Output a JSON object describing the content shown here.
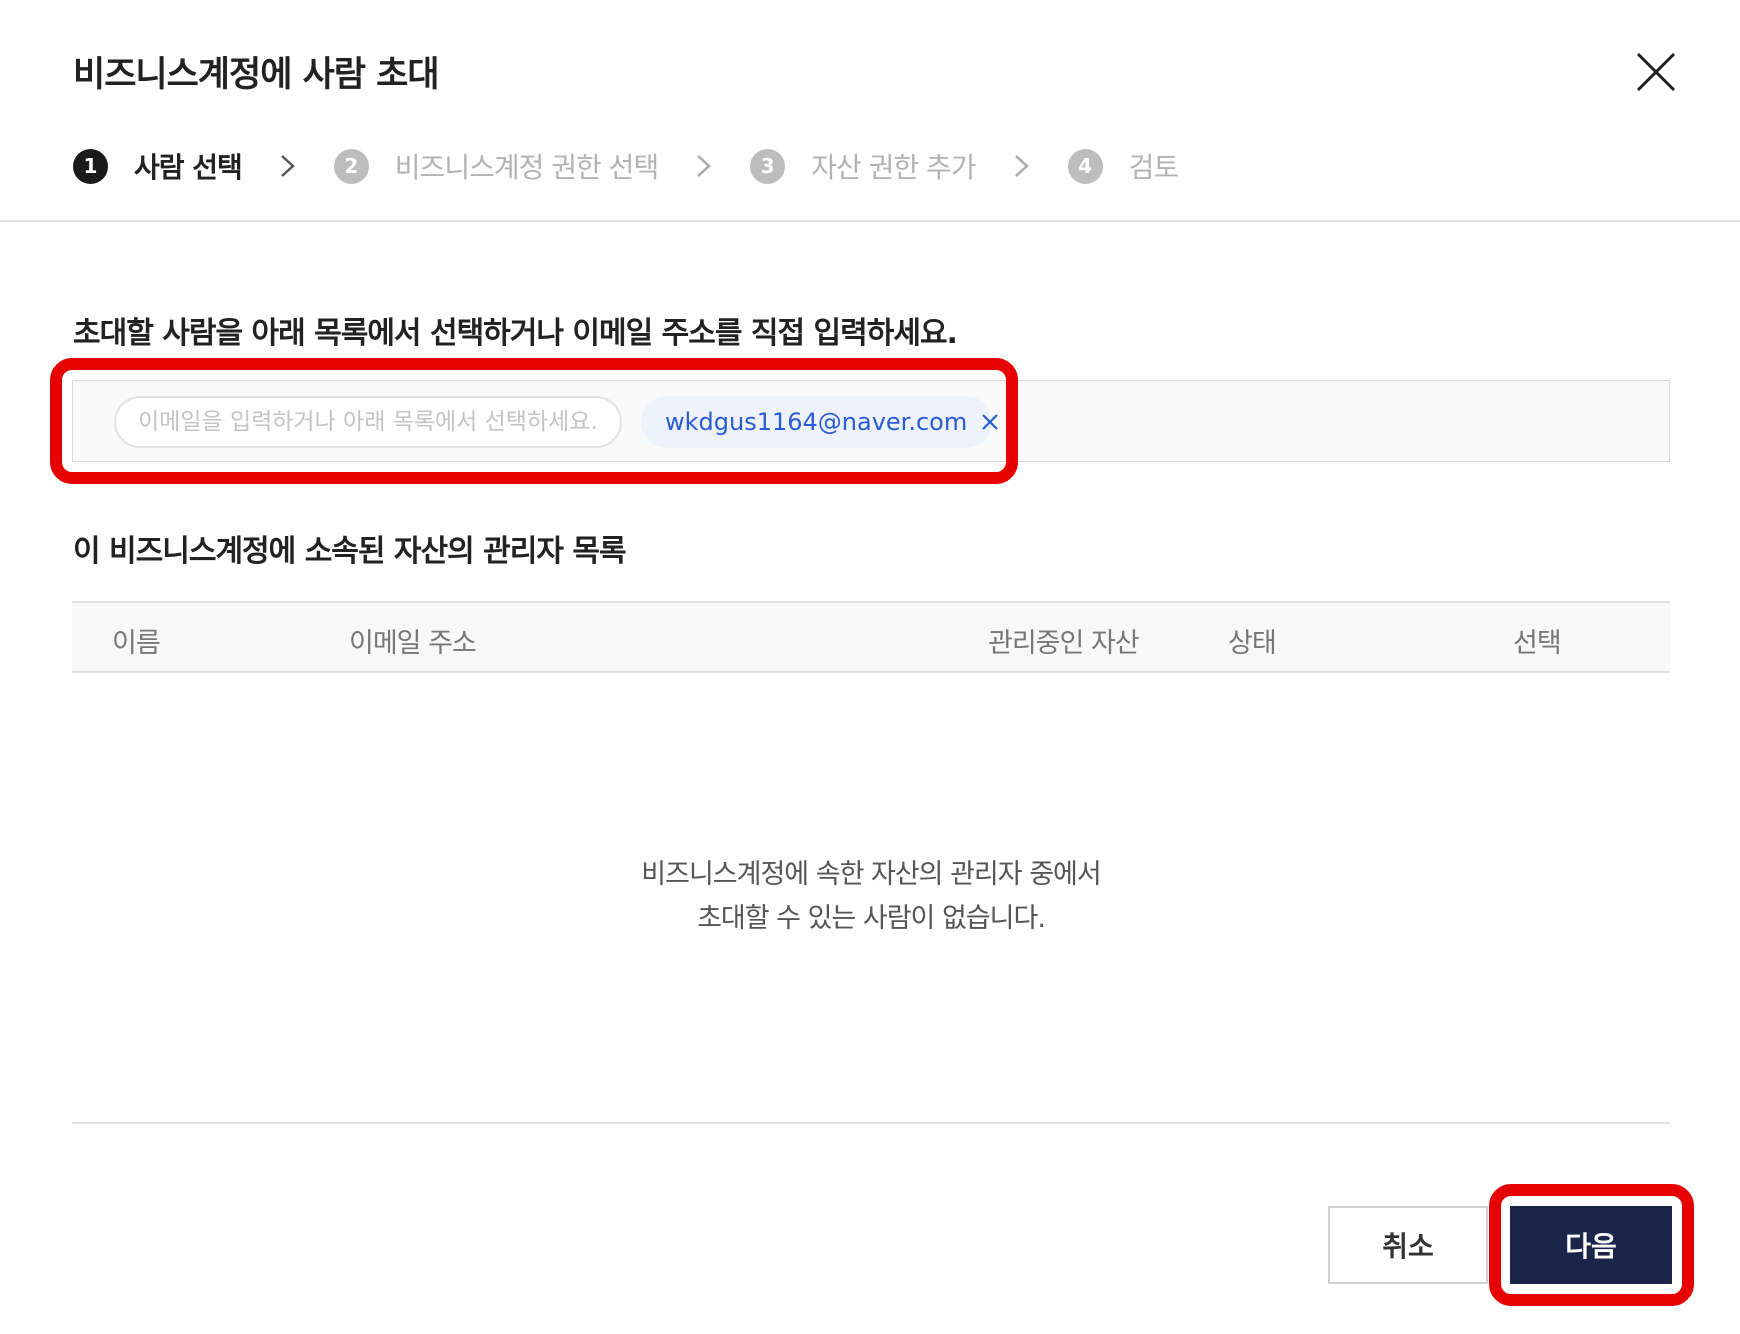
{
  "dialog": {
    "title": "비즈니스계정에 사람 초대",
    "close_icon": "close-icon"
  },
  "stepper": {
    "steps": [
      {
        "number": "1",
        "label": "사람 선택",
        "active": true
      },
      {
        "number": "2",
        "label": "비즈니스계정 권한 선택",
        "active": false
      },
      {
        "number": "3",
        "label": "자산 권한 추가",
        "active": false
      },
      {
        "number": "4",
        "label": "검토",
        "active": false
      }
    ],
    "separator_icon": "chevron-right-icon"
  },
  "invite": {
    "instruction": "초대할 사람을 아래 목록에서 선택하거나 이메일 주소를 직접 입력하세요.",
    "input_placeholder": "이메일을 입력하거나 아래 목록에서 선택하세요.",
    "input_value": "",
    "chips": [
      {
        "email": "wkdgus1164@naver.com",
        "remove_icon": "close-icon"
      }
    ]
  },
  "admins": {
    "title": "이 비즈니스계정에 소속된 자산의 관리자 목록",
    "columns": {
      "name": "이름",
      "email": "이메일 주소",
      "assets": "관리중인 자산",
      "status": "상태",
      "select": "선택"
    },
    "rows": [],
    "empty_message": {
      "line1": "비즈니스계정에 속한 자산의 관리자 중에서",
      "line2": "초대할 수 있는 사람이 없습니다."
    }
  },
  "footer": {
    "cancel_label": "취소",
    "next_label": "다음"
  },
  "colors": {
    "primary_button": "#1b2549",
    "chip_text": "#2a5bd7",
    "chip_bg": "#eef2fb",
    "annotation": "#e60000"
  }
}
